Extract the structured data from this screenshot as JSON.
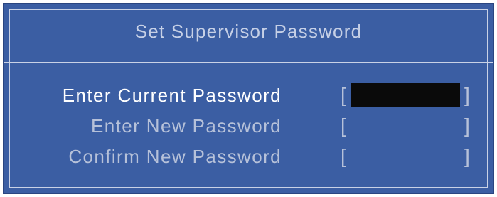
{
  "dialog": {
    "title": "Set Supervisor Password",
    "colors": {
      "background": "#3b5ea3",
      "frame": "#c9d2e6",
      "active_text": "#ffffff",
      "inactive_text": "#b6c1d9",
      "active_input": "#0a0a0a"
    },
    "fields": [
      {
        "label": "Enter Current Password",
        "open_bracket": "[",
        "close_bracket": "]",
        "value": "",
        "active": true
      },
      {
        "label": "Enter New Password",
        "open_bracket": "[",
        "close_bracket": "]",
        "value": "",
        "active": false
      },
      {
        "label": "Confirm New Password",
        "open_bracket": "[",
        "close_bracket": "]",
        "value": "",
        "active": false
      }
    ]
  }
}
